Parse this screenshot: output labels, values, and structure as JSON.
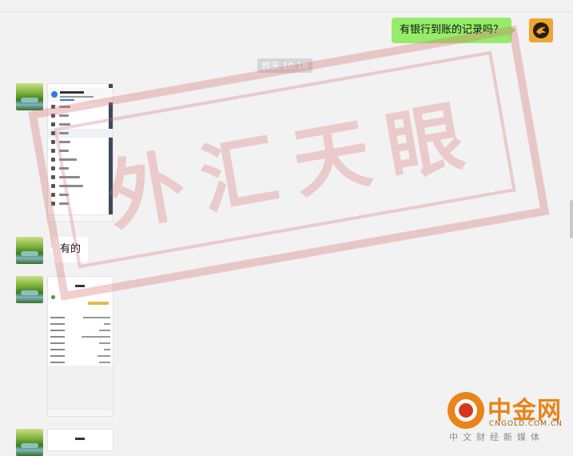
{
  "chat": {
    "outgoing_message": "有银行到账的记录吗？",
    "timestamp": "昨天 10:18",
    "incoming_reply": "有的"
  },
  "watermark": {
    "text": "外汇天眼"
  },
  "logo": {
    "name": "中金网",
    "domain": "CNGOLD.COM.CN",
    "tagline": "中文财经新媒体"
  },
  "icons": {
    "contact_avatar": "landscape-avatar",
    "self_avatar": "eagle-avatar"
  },
  "colors": {
    "outgoing_bubble": "#95ec69",
    "logo_orange": "#e8841a"
  }
}
